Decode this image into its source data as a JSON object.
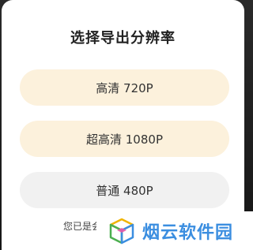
{
  "dialog": {
    "title": "选择导出分辨率",
    "options": [
      {
        "label": "高清 720P"
      },
      {
        "label": "超高清 1080P"
      },
      {
        "label": "普通 480P"
      }
    ],
    "footer_note": "您已是会"
  },
  "watermark": {
    "text": "烟云软件园",
    "icon": "cube-logo-icon"
  },
  "colors": {
    "option_warm_bg": "#fcf1dc",
    "option_plain_bg": "#f1f1f1",
    "watermark_text": "#3b8ee0"
  }
}
